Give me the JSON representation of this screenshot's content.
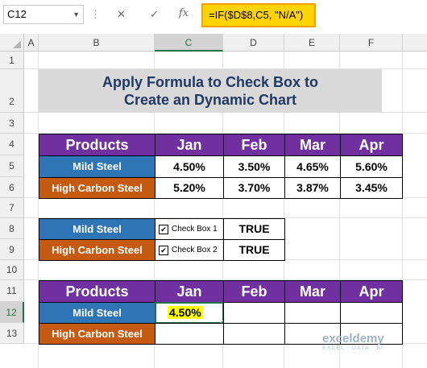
{
  "formula_bar": {
    "name_box": "C12",
    "fx_label": "fx",
    "formula": "=IF($D$8,C5, \"N/A\")"
  },
  "columns": [
    "A",
    "B",
    "C",
    "D",
    "E",
    "F"
  ],
  "rows": [
    "1",
    "2",
    "3",
    "4",
    "5",
    "6",
    "7",
    "8",
    "9",
    "10",
    "11",
    "12",
    "13"
  ],
  "selected_cell": {
    "column": "C",
    "row": "12"
  },
  "title": {
    "line1": "Apply Formula to Check Box to",
    "line2": "Create an Dynamic Chart"
  },
  "table1": {
    "header": [
      "Products",
      "Jan",
      "Feb",
      "Mar",
      "Apr"
    ],
    "rows": [
      {
        "product": "Mild Steel",
        "values": [
          "4.50%",
          "3.50%",
          "4.65%",
          "5.60%"
        ]
      },
      {
        "product": "High Carbon Steel",
        "values": [
          "5.20%",
          "3.70%",
          "3.87%",
          "3.45%"
        ]
      }
    ]
  },
  "table2": {
    "rows": [
      {
        "product": "Mild Steel",
        "checkbox_label": "Check Box 1",
        "checked": true,
        "value": "TRUE"
      },
      {
        "product": "High Carbon Steel",
        "checkbox_label": "Check Box 2",
        "checked": true,
        "value": "TRUE"
      }
    ]
  },
  "table3": {
    "header": [
      "Products",
      "Jan",
      "Feb",
      "Mar",
      "Apr"
    ],
    "rows": [
      {
        "product": "Mild Steel",
        "values": [
          "4.50%",
          "",
          "",
          ""
        ]
      },
      {
        "product": "High Carbon Steel",
        "values": [
          "",
          "",
          "",
          ""
        ]
      }
    ]
  },
  "watermark": {
    "name": "exceldemy",
    "tagline": "EXCEL · DATA · BI"
  },
  "colors": {
    "purple": "#7030a0",
    "blue": "#2e75b6",
    "orange": "#c55a11",
    "title_text": "#1f3864",
    "highlight": "#ffd400"
  }
}
